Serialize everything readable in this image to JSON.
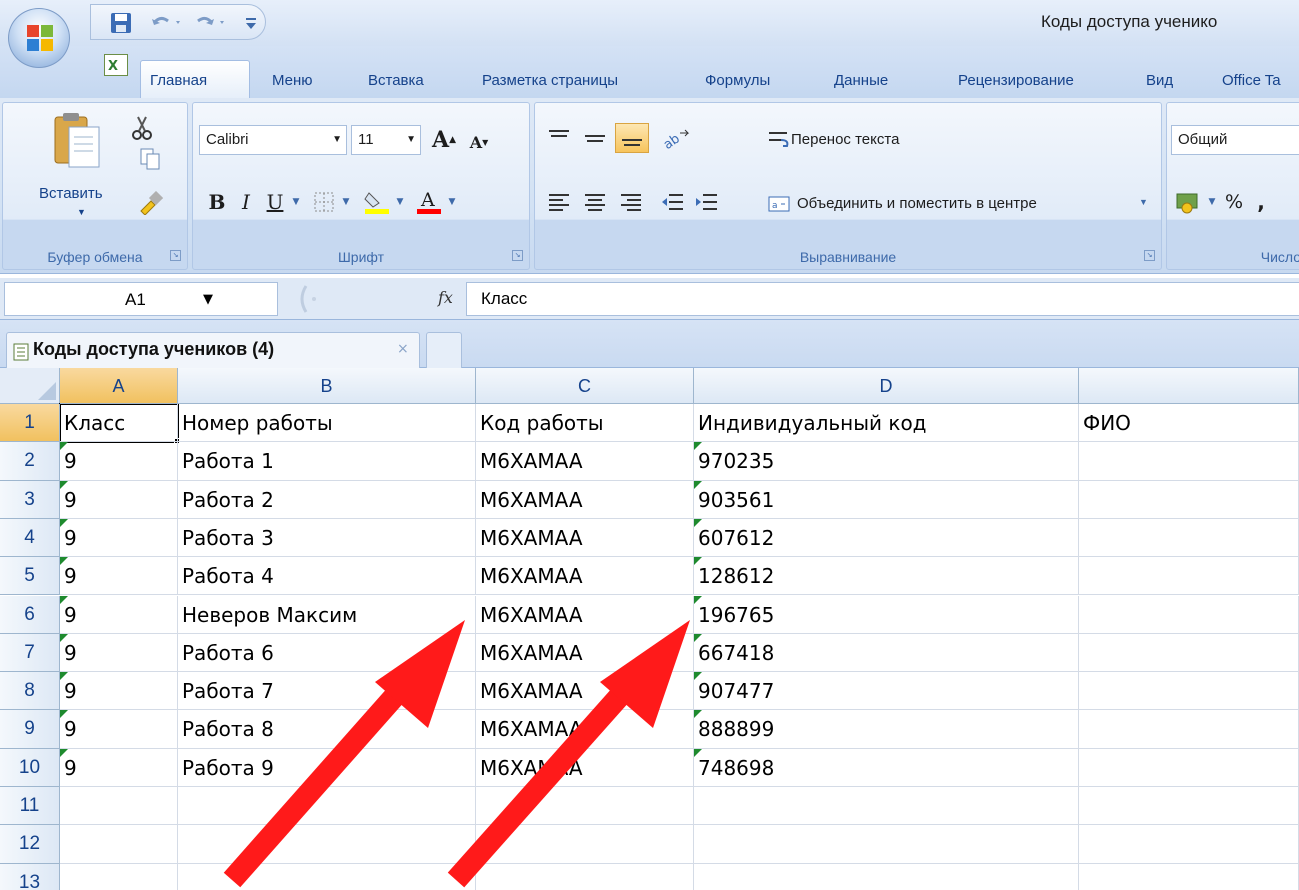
{
  "window": {
    "title": "Коды доступа ученико"
  },
  "ribbon_tabs": [
    "Главная",
    "Меню",
    "Вставка",
    "Разметка страницы",
    "Формулы",
    "Данные",
    "Рецензирование",
    "Вид",
    "Office Ta"
  ],
  "clipboard": {
    "paste_label": "Вставить",
    "group_label": "Буфер обмена"
  },
  "font": {
    "name": "Calibri",
    "size": "11",
    "group_label": "Шрифт"
  },
  "alignment": {
    "wrap_text": "Перенос текста",
    "merge_center": "Объединить и поместить в центре",
    "group_label": "Выравнивание"
  },
  "number": {
    "format": "Общий",
    "percent": "%",
    "group_label": "Число"
  },
  "formula_bar": {
    "name_box": "A1",
    "formula": "Класс",
    "fx": "fx"
  },
  "workbook_tab": {
    "label": "Коды доступа учеников (4)",
    "close": "×"
  },
  "columns": [
    "A",
    "B",
    "C",
    "D"
  ],
  "rows": [
    [
      "Класс",
      "Номер работы",
      "Код работы",
      "Индивидуальный код",
      "ФИО"
    ],
    [
      "9",
      "Работа 1",
      "M6XAMAA",
      "970235",
      ""
    ],
    [
      "9",
      "Работа 2",
      "M6XAMAA",
      "903561",
      ""
    ],
    [
      "9",
      "Работа 3",
      "M6XAMAA",
      "607612",
      ""
    ],
    [
      "9",
      "Работа 4",
      "M6XAMAA",
      "128612",
      ""
    ],
    [
      "9",
      "Неверов Максим",
      "M6XAMAA",
      "196765",
      ""
    ],
    [
      "9",
      "Работа 6",
      "M6XAMAA",
      "667418",
      ""
    ],
    [
      "9",
      "Работа 7",
      "M6XAMAA",
      "907477",
      ""
    ],
    [
      "9",
      "Работа 8",
      "M6XAMAA",
      "888899",
      ""
    ],
    [
      "9",
      "Работа 9",
      "M6XAMAA",
      "748698",
      ""
    ],
    [
      "",
      "",
      "",
      "",
      ""
    ],
    [
      "",
      "",
      "",
      "",
      ""
    ]
  ],
  "row_numbers": [
    "1",
    "2",
    "3",
    "4",
    "5",
    "6",
    "7",
    "8",
    "9",
    "10",
    "11",
    "12",
    "13"
  ],
  "colors": {
    "arrow": "#ff1a1a",
    "selection_header": "#f1c15f",
    "text_number_marker": "#1e8a2e"
  }
}
